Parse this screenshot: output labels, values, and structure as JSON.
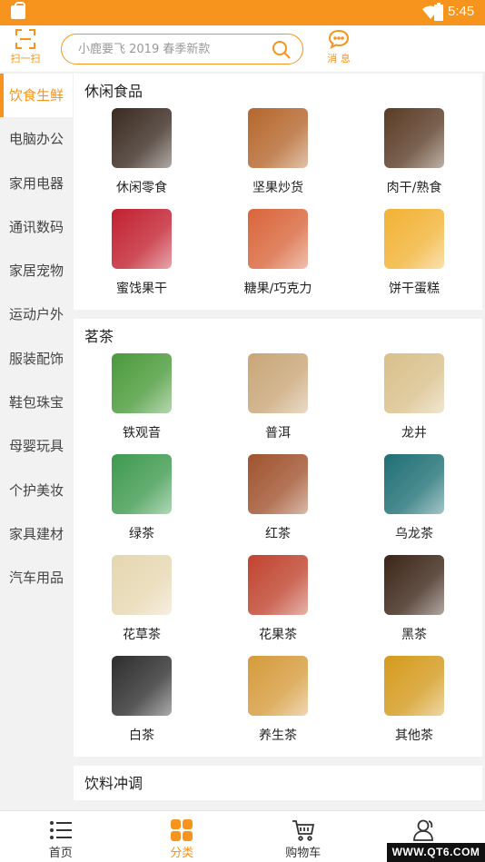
{
  "status_bar": {
    "time": "5:45"
  },
  "header": {
    "scan_label": "扫一扫",
    "search_placeholder": "小鹿要飞 2019 春季新款",
    "message_label": "消 息"
  },
  "sidebar": {
    "items": [
      {
        "label": "饮食生鲜",
        "active": true
      },
      {
        "label": "电脑办公"
      },
      {
        "label": "家用电器"
      },
      {
        "label": "通讯数码"
      },
      {
        "label": "家居宠物"
      },
      {
        "label": "运动户外"
      },
      {
        "label": "服装配饰"
      },
      {
        "label": "鞋包珠宝"
      },
      {
        "label": "母婴玩具"
      },
      {
        "label": "个护美妆"
      },
      {
        "label": "家具建材"
      },
      {
        "label": "汽车用品"
      }
    ]
  },
  "sections": [
    {
      "title": "休闲食品",
      "items": [
        {
          "label": "休闲零食",
          "color": "#3a2a20"
        },
        {
          "label": "坚果炒货",
          "color": "#b5662c"
        },
        {
          "label": "肉干/熟食",
          "color": "#5a3b25"
        },
        {
          "label": "蜜饯果干",
          "color": "#c2202f"
        },
        {
          "label": "糖果/巧克力",
          "color": "#d9653a"
        },
        {
          "label": "饼干蛋糕",
          "color": "#f2b234"
        }
      ]
    },
    {
      "title": "茗茶",
      "items": [
        {
          "label": "铁观音",
          "color": "#4a9a3a"
        },
        {
          "label": "普洱",
          "color": "#c9a677"
        },
        {
          "label": "龙井",
          "color": "#d9c08a"
        },
        {
          "label": "绿茶",
          "color": "#3d9a4e"
        },
        {
          "label": "红茶",
          "color": "#a0522d"
        },
        {
          "label": "乌龙茶",
          "color": "#1e6f74"
        },
        {
          "label": "花草茶",
          "color": "#e6d7b0"
        },
        {
          "label": "花果茶",
          "color": "#c0432e"
        },
        {
          "label": "黑茶",
          "color": "#3b2417"
        },
        {
          "label": "白茶",
          "color": "#2d2d2d"
        },
        {
          "label": "养生茶",
          "color": "#d69b3c"
        },
        {
          "label": "其他茶",
          "color": "#d49a1c"
        }
      ]
    },
    {
      "title": "饮料冲调",
      "items": []
    }
  ],
  "bottom_nav": {
    "tabs": [
      {
        "label": "首页",
        "icon": "list-icon"
      },
      {
        "label": "分类",
        "icon": "category-icon",
        "active": true
      },
      {
        "label": "购物车",
        "icon": "cart-icon"
      },
      {
        "label": "",
        "icon": "user-icon"
      }
    ]
  },
  "watermark": "WWW.QT6.COM",
  "colors": {
    "accent": "#f7941d",
    "text": "#222222",
    "background": "#f2f2f2"
  }
}
